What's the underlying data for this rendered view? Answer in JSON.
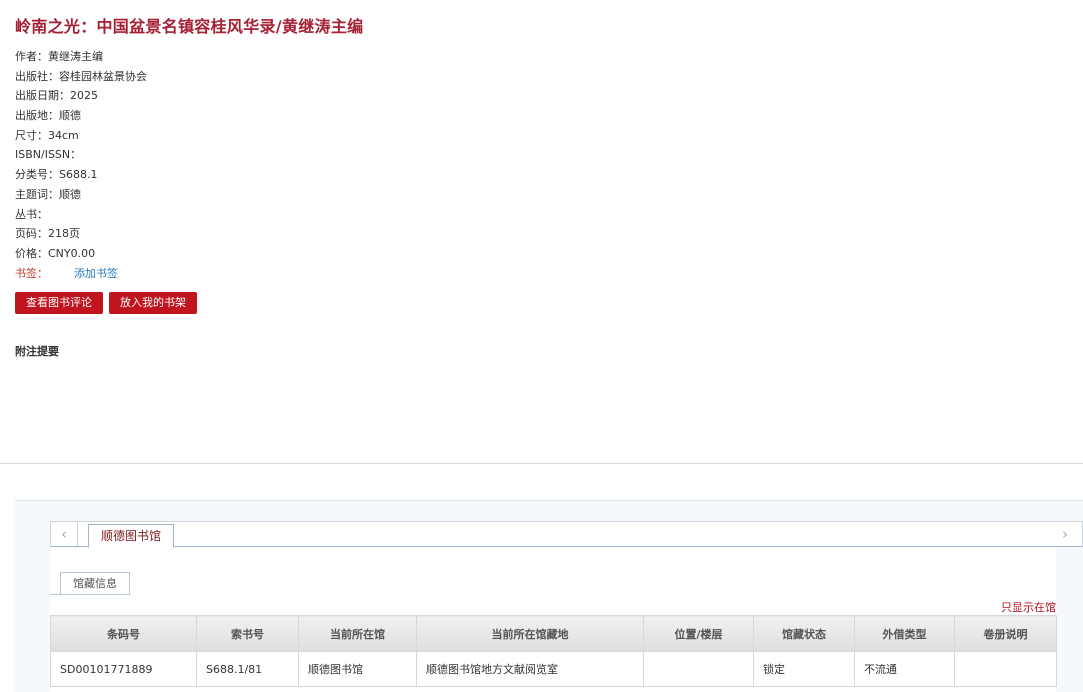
{
  "book": {
    "title": "岭南之光：中国盆景名镇容桂风华录/黄继涛主编"
  },
  "meta": [
    "作者：黄继涛主编",
    "出版社：容桂园林盆景协会",
    "出版日期：2025",
    "出版地：顺德",
    "尺寸：34cm",
    "ISBN/ISSN：",
    "分类号：S688.1",
    "主题词：顺德",
    "丛书：",
    "页码：218页",
    "价格：CNY0.00"
  ],
  "bookmark": {
    "label": "书签：",
    "add_label": "添加书签"
  },
  "buttons": {
    "view_reviews": "查看图书评论",
    "add_shelf": "放入我的书架"
  },
  "notes_heading": "附注提要",
  "library_tabs": {
    "prev_icon": "‹",
    "next_icon": "›",
    "active": "顺德图书馆"
  },
  "holdings": {
    "subtab": "馆藏信息",
    "only_in_library": "只显示在馆",
    "headers": [
      "条码号",
      "索书号",
      "当前所在馆",
      "当前所在馆藏地",
      "位置/楼层",
      "馆藏状态",
      "外借类型",
      "卷册说明"
    ],
    "rows": [
      [
        "SD00101771889",
        "S688.1/81",
        "顺德图书馆",
        "顺德图书馆地方文献阅览室",
        "",
        "锁定",
        "不流通",
        ""
      ]
    ]
  },
  "colors": {
    "title": "#a52035",
    "button": "#c0141e",
    "link": "#2a7ab8"
  }
}
